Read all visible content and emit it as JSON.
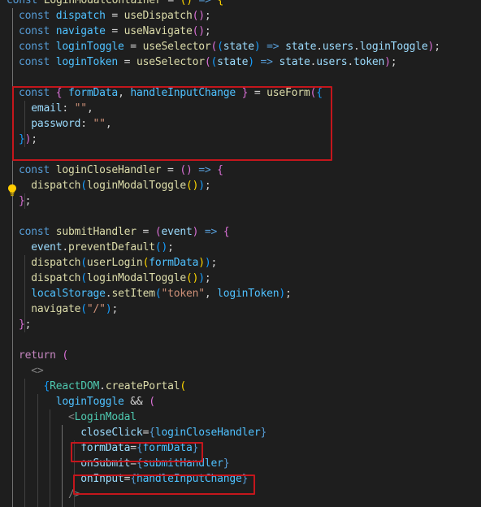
{
  "lines": [
    [
      [
        "k",
        "const "
      ],
      [
        "f",
        "LoginModalContainer"
      ],
      [
        "t",
        " = "
      ],
      [
        "b1",
        "()"
      ],
      [
        "t",
        " "
      ],
      [
        "k",
        "=>"
      ],
      [
        "t",
        " "
      ],
      [
        "b1",
        "{"
      ]
    ],
    [
      [
        "k",
        "const "
      ],
      [
        "v",
        "dispatch"
      ],
      [
        "t",
        " = "
      ],
      [
        "f",
        "useDispatch"
      ],
      [
        "b2",
        "()"
      ],
      [
        "t",
        ";"
      ]
    ],
    [
      [
        "k",
        "const "
      ],
      [
        "v",
        "navigate"
      ],
      [
        "t",
        " = "
      ],
      [
        "f",
        "useNavigate"
      ],
      [
        "b2",
        "()"
      ],
      [
        "t",
        ";"
      ]
    ],
    [
      [
        "k",
        "const "
      ],
      [
        "v",
        "loginToggle"
      ],
      [
        "t",
        " = "
      ],
      [
        "f",
        "useSelector"
      ],
      [
        "b2",
        "("
      ],
      [
        "b3",
        "("
      ],
      [
        "p",
        "state"
      ],
      [
        "b3",
        ")"
      ],
      [
        "t",
        " "
      ],
      [
        "k",
        "=>"
      ],
      [
        "t",
        " "
      ],
      [
        "p",
        "state"
      ],
      [
        "t",
        "."
      ],
      [
        "p",
        "users"
      ],
      [
        "t",
        "."
      ],
      [
        "p",
        "loginToggle"
      ],
      [
        "b2",
        ")"
      ],
      [
        "t",
        ";"
      ]
    ],
    [
      [
        "k",
        "const "
      ],
      [
        "v",
        "loginToken"
      ],
      [
        "t",
        " = "
      ],
      [
        "f",
        "useSelector"
      ],
      [
        "b2",
        "("
      ],
      [
        "b3",
        "("
      ],
      [
        "p",
        "state"
      ],
      [
        "b3",
        ")"
      ],
      [
        "t",
        " "
      ],
      [
        "k",
        "=>"
      ],
      [
        "t",
        " "
      ],
      [
        "p",
        "state"
      ],
      [
        "t",
        "."
      ],
      [
        "p",
        "users"
      ],
      [
        "t",
        "."
      ],
      [
        "p",
        "token"
      ],
      [
        "b2",
        ")"
      ],
      [
        "t",
        ";"
      ]
    ],
    [],
    [
      [
        "k",
        "const "
      ],
      [
        "b2",
        "{"
      ],
      [
        "t",
        " "
      ],
      [
        "v",
        "formData"
      ],
      [
        "t",
        ", "
      ],
      [
        "v",
        "handleInputChange"
      ],
      [
        "t",
        " "
      ],
      [
        "b2",
        "}"
      ],
      [
        "t",
        " = "
      ],
      [
        "f",
        "useForm"
      ],
      [
        "b2",
        "("
      ],
      [
        "b3",
        "{"
      ]
    ],
    [
      [
        "t",
        "  "
      ],
      [
        "p",
        "email"
      ],
      [
        "t",
        ": "
      ],
      [
        "s",
        "\"\""
      ],
      [
        "t",
        ","
      ]
    ],
    [
      [
        "t",
        "  "
      ],
      [
        "p",
        "password"
      ],
      [
        "t",
        ": "
      ],
      [
        "s",
        "\"\""
      ],
      [
        "t",
        ","
      ]
    ],
    [
      [
        "b3",
        "}"
      ],
      [
        "b2",
        ")"
      ],
      [
        "t",
        ";"
      ]
    ],
    [],
    [
      [
        "k",
        "const "
      ],
      [
        "f",
        "loginCloseHandler"
      ],
      [
        "t",
        " = "
      ],
      [
        "b2",
        "()"
      ],
      [
        "t",
        " "
      ],
      [
        "k",
        "=>"
      ],
      [
        "t",
        " "
      ],
      [
        "b2",
        "{"
      ]
    ],
    [
      [
        "t",
        "  "
      ],
      [
        "f",
        "dispatch"
      ],
      [
        "b3",
        "("
      ],
      [
        "f",
        "loginModalToggle"
      ],
      [
        "b1",
        "()"
      ],
      [
        "b3",
        ")"
      ],
      [
        "t",
        ";"
      ]
    ],
    [
      [
        "b2",
        "}"
      ],
      [
        "t",
        ";"
      ]
    ],
    [],
    [
      [
        "k",
        "const "
      ],
      [
        "f",
        "submitHandler"
      ],
      [
        "t",
        " = "
      ],
      [
        "b2",
        "("
      ],
      [
        "p",
        "event"
      ],
      [
        "b2",
        ")"
      ],
      [
        "t",
        " "
      ],
      [
        "k",
        "=>"
      ],
      [
        "t",
        " "
      ],
      [
        "b2",
        "{"
      ]
    ],
    [
      [
        "t",
        "  "
      ],
      [
        "p",
        "event"
      ],
      [
        "t",
        "."
      ],
      [
        "f",
        "preventDefault"
      ],
      [
        "b3",
        "()"
      ],
      [
        "t",
        ";"
      ]
    ],
    [
      [
        "t",
        "  "
      ],
      [
        "f",
        "dispatch"
      ],
      [
        "b3",
        "("
      ],
      [
        "f",
        "userLogin"
      ],
      [
        "b1",
        "("
      ],
      [
        "v",
        "formData"
      ],
      [
        "b1",
        ")"
      ],
      [
        "b3",
        ")"
      ],
      [
        "t",
        ";"
      ]
    ],
    [
      [
        "t",
        "  "
      ],
      [
        "f",
        "dispatch"
      ],
      [
        "b3",
        "("
      ],
      [
        "f",
        "loginModalToggle"
      ],
      [
        "b1",
        "()"
      ],
      [
        "b3",
        ")"
      ],
      [
        "t",
        ";"
      ]
    ],
    [
      [
        "t",
        "  "
      ],
      [
        "v",
        "localStorage"
      ],
      [
        "t",
        "."
      ],
      [
        "f",
        "setItem"
      ],
      [
        "b3",
        "("
      ],
      [
        "s",
        "\"token\""
      ],
      [
        "t",
        ", "
      ],
      [
        "v",
        "loginToken"
      ],
      [
        "b3",
        ")"
      ],
      [
        "t",
        ";"
      ]
    ],
    [
      [
        "t",
        "  "
      ],
      [
        "f",
        "navigate"
      ],
      [
        "b3",
        "("
      ],
      [
        "s",
        "\"/\""
      ],
      [
        "b3",
        ")"
      ],
      [
        "t",
        ";"
      ]
    ],
    [
      [
        "b2",
        "}"
      ],
      [
        "t",
        ";"
      ]
    ],
    [],
    [
      [
        "ctl",
        "return"
      ],
      [
        "t",
        " "
      ],
      [
        "b2",
        "("
      ]
    ],
    [
      [
        "t",
        "  "
      ],
      [
        "tb",
        "<>"
      ]
    ],
    [
      [
        "t",
        "    "
      ],
      [
        "b3",
        "{"
      ],
      [
        "ty",
        "ReactDOM"
      ],
      [
        "t",
        "."
      ],
      [
        "f",
        "createPortal"
      ],
      [
        "b1",
        "("
      ]
    ],
    [
      [
        "t",
        "      "
      ],
      [
        "v",
        "loginToggle"
      ],
      [
        "t",
        " && "
      ],
      [
        "b2",
        "("
      ]
    ],
    [
      [
        "t",
        "        "
      ],
      [
        "tb",
        "<"
      ],
      [
        "tag",
        "LoginModal"
      ]
    ],
    [
      [
        "t",
        "          "
      ],
      [
        "p",
        "closeClick"
      ],
      [
        "t",
        "="
      ],
      [
        "k",
        "{"
      ],
      [
        "v",
        "loginCloseHandler"
      ],
      [
        "k",
        "}"
      ]
    ],
    [
      [
        "t",
        "          "
      ],
      [
        "p",
        "formData"
      ],
      [
        "t",
        "="
      ],
      [
        "k",
        "{"
      ],
      [
        "v",
        "formData"
      ],
      [
        "k",
        "}"
      ]
    ],
    [
      [
        "t",
        "          "
      ],
      [
        "p",
        "onSubmit"
      ],
      [
        "t",
        "="
      ],
      [
        "k",
        "{"
      ],
      [
        "v",
        "submitHandler"
      ],
      [
        "k",
        "}"
      ]
    ],
    [
      [
        "t",
        "          "
      ],
      [
        "p",
        "onInput"
      ],
      [
        "t",
        "="
      ],
      [
        "k",
        "{"
      ],
      [
        "v",
        "handleInputChange"
      ],
      [
        "k",
        "}"
      ]
    ],
    [
      [
        "t",
        "        "
      ],
      [
        "tb",
        "/>"
      ]
    ]
  ],
  "lightbulb_icon": "lightbulb-icon",
  "theme": {
    "background": "#1e1e1e",
    "highlight_box": "#c4161c"
  }
}
